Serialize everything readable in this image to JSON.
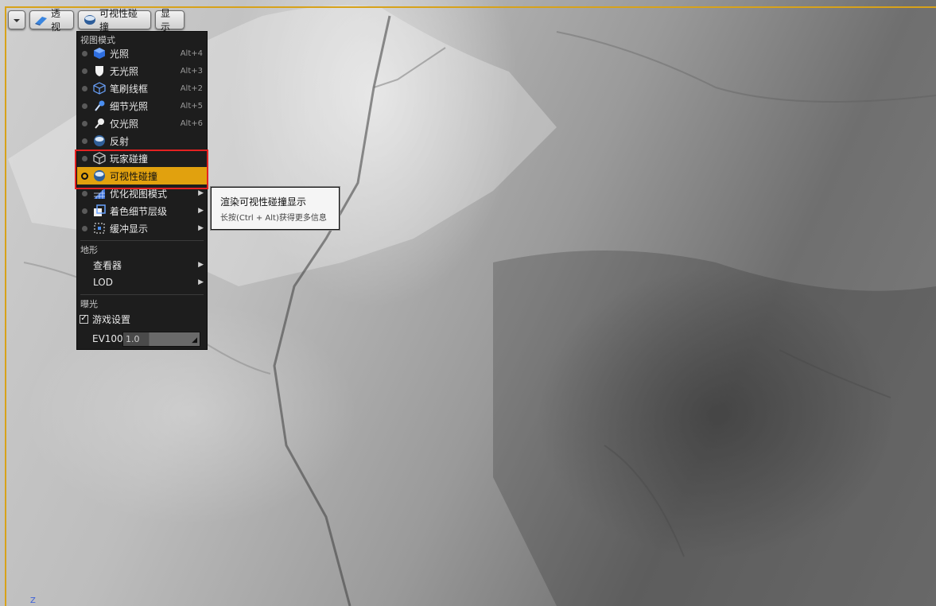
{
  "toolbar": {
    "perspective_label": "透视",
    "view_mode_label": "可视性碰撞",
    "show_label": "显示"
  },
  "menu": {
    "view_mode_header": "视图模式",
    "items": [
      {
        "label": "光照",
        "shortcut": "Alt+4",
        "icon": "lit-cube-icon"
      },
      {
        "label": "无光照",
        "shortcut": "Alt+3",
        "icon": "unlit-shield-icon"
      },
      {
        "label": "笔刷线框",
        "shortcut": "Alt+2",
        "icon": "wireframe-cube-icon"
      },
      {
        "label": "细节光照",
        "shortcut": "Alt+5",
        "icon": "detail-lighting-icon"
      },
      {
        "label": "仅光照",
        "shortcut": "Alt+6",
        "icon": "lighting-only-icon"
      },
      {
        "label": "反射",
        "shortcut": "",
        "icon": "reflection-sphere-icon"
      },
      {
        "label": "玩家碰撞",
        "shortcut": "",
        "icon": "player-collision-icon"
      },
      {
        "label": "可视性碰撞",
        "shortcut": "",
        "icon": "visibility-collision-icon",
        "selected": true
      },
      {
        "label": "优化视图模式",
        "shortcut": "",
        "icon": "optimization-grid-icon",
        "submenu": true
      },
      {
        "label": "着色细节层级",
        "shortcut": "",
        "icon": "shading-lod-icon",
        "submenu": true
      },
      {
        "label": "缓冲显示",
        "shortcut": "",
        "icon": "buffer-visualization-icon",
        "submenu": true
      }
    ],
    "landscape_header": "地形",
    "landscape_items": [
      {
        "label": "查看器",
        "submenu": true
      },
      {
        "label": "LOD",
        "submenu": true
      }
    ],
    "exposure_header": "曝光",
    "game_settings_label": "游戏设置",
    "game_settings_checked": true,
    "ev100_label": "EV100",
    "ev100_value": "1.0"
  },
  "tooltip": {
    "title": "渲染可视性碰撞显示",
    "hint": "长按(Ctrl + Alt)获得更多信息"
  },
  "viewport": {
    "axis_label": "Z"
  },
  "colors": {
    "selected": "#e1a10e",
    "highlight_border": "#e52222",
    "viewport_border": "#d7a21a"
  }
}
